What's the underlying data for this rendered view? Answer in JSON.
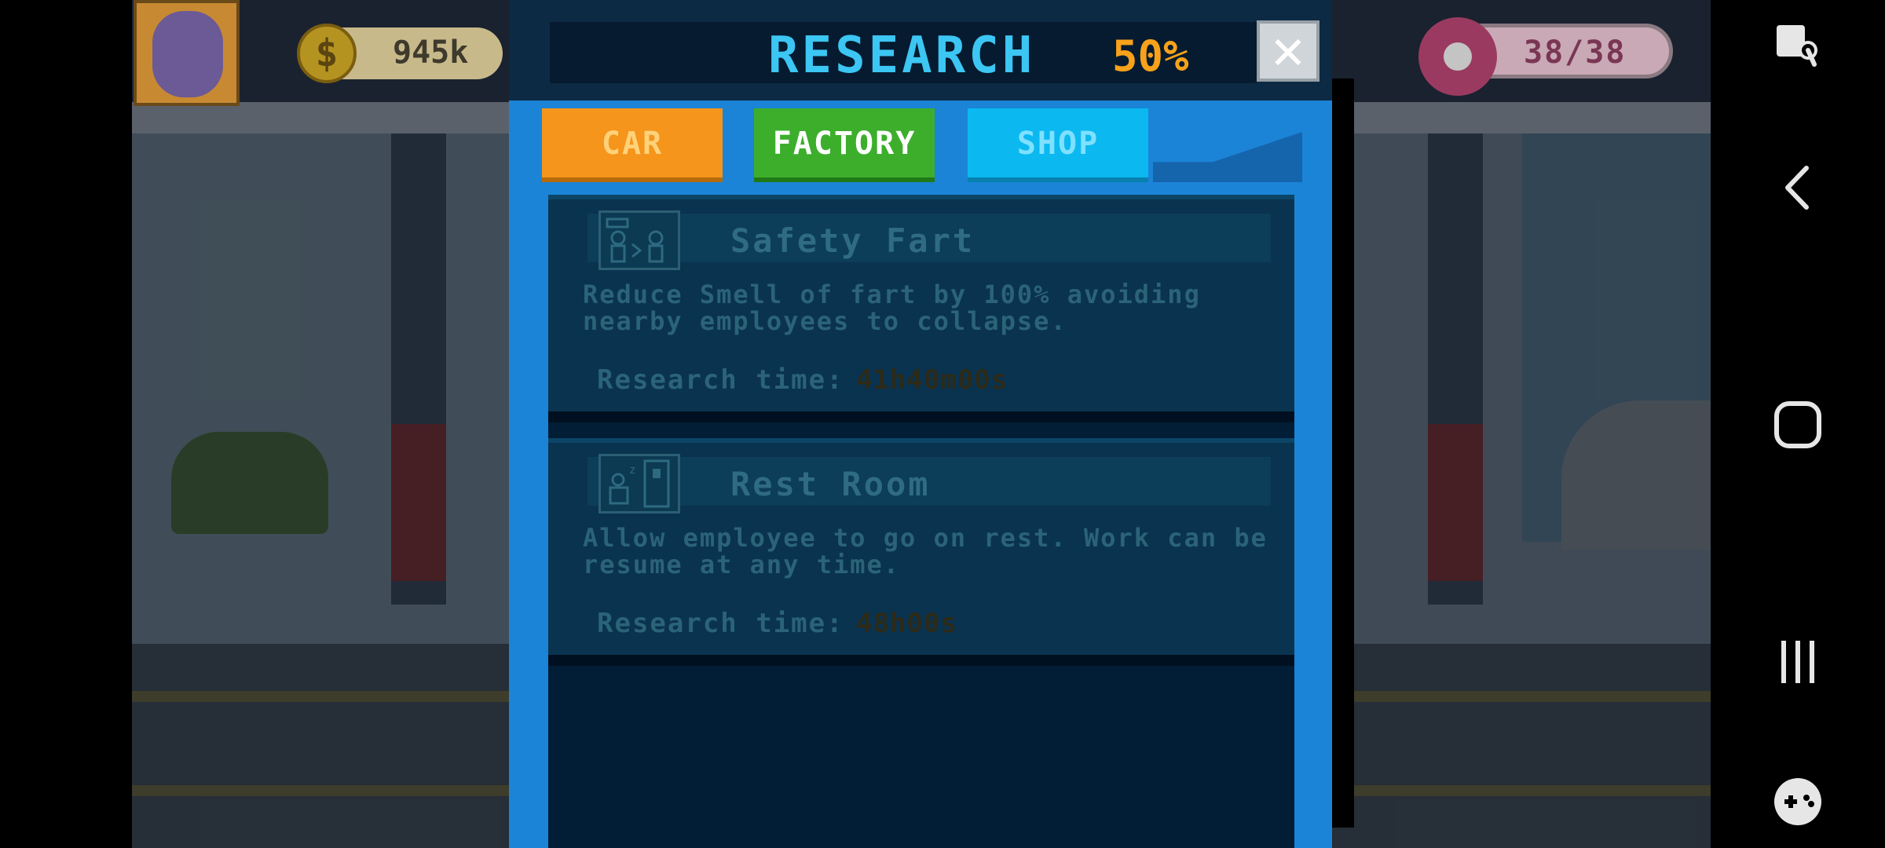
{
  "hud": {
    "coins": "945k",
    "coin_symbol": "$",
    "energy": "38/38"
  },
  "research": {
    "title": "RESEARCH",
    "progress": "50%",
    "close_label": "✕",
    "tabs": [
      {
        "label": "CAR"
      },
      {
        "label": "FACTORY"
      },
      {
        "label": "SHOP"
      }
    ],
    "items": [
      {
        "title": "Safety Fart",
        "description": "Reduce Smell of fart by 100% avoiding nearby employees to collapse.",
        "time_label": "Research time:",
        "time_value": "41h40m00s",
        "icon": "fart-icon"
      },
      {
        "title": "Rest Room",
        "description": "Allow employee to go on rest. Work can be resume at any time.",
        "time_label": "Research time:",
        "time_value": "48h00s",
        "icon": "rest-room-icon"
      }
    ]
  },
  "colors": {
    "panel": "#1b84d6",
    "title": "#3cc6f3",
    "progress": "#f7a21a",
    "tab_car": "#f5951c",
    "tab_factory": "#3cae2c",
    "tab_shop": "#0bb9f0"
  },
  "system_nav": {
    "icons": [
      "accessibility-icon",
      "back-icon",
      "home-icon",
      "recents-icon",
      "game-controller-icon"
    ]
  }
}
